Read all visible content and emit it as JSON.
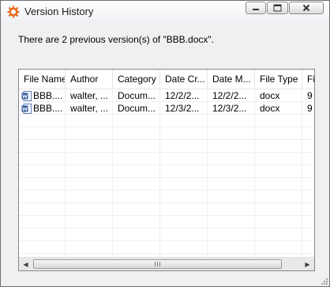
{
  "window": {
    "title": "Version History",
    "minimize_label": "minimize",
    "maximize_label": "maximize",
    "close_label": "close"
  },
  "message": "There are 2 previous version(s) of \"BBB.docx\".",
  "table": {
    "columns": [
      "File Name",
      "Author",
      "Category",
      "Date Cr...",
      "Date M...",
      "File Type",
      "Fi"
    ],
    "rows": [
      {
        "file_name": "BBB....",
        "author": "walter, ...",
        "category": "Docum...",
        "date_created": "12/2/2...",
        "date_modified": "12/2/2...",
        "file_type": "docx",
        "file_size": "9"
      },
      {
        "file_name": "BBB....",
        "author": "walter, ...",
        "category": "Docum...",
        "date_created": "12/3/2...",
        "date_modified": "12/3/2...",
        "file_type": "docx",
        "file_size": "9"
      }
    ]
  },
  "icons": {
    "app": "orange-gear-icon",
    "file": "word-document-icon",
    "scroll_left": "scroll-left-arrow-icon",
    "scroll_right": "scroll-right-arrow-icon"
  },
  "colors": {
    "border": "#828790",
    "window_bg": "#f0f0f0",
    "gear": "#e8691b",
    "word_blue": "#2b579a"
  }
}
